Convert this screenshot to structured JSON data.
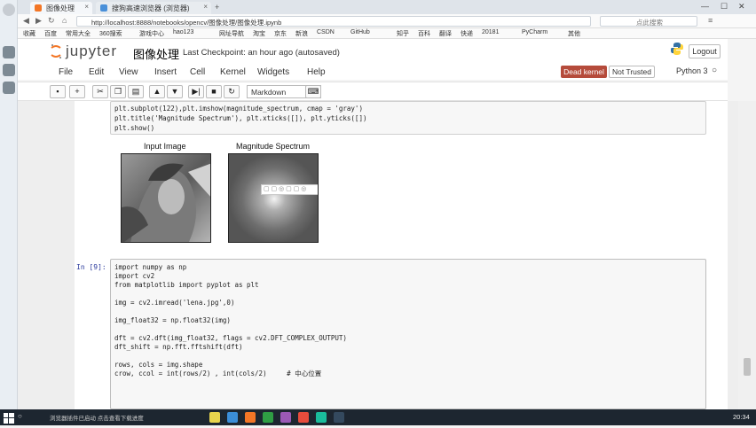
{
  "browser": {
    "tabs": [
      {
        "label": "图像处理"
      },
      {
        "label": "搜狗高速浏览器 (浏览器)"
      }
    ],
    "address": "http://localhost:8888/notebooks/opencv/图像处理/图像处理.ipynb",
    "search_placeholder": "点此搜索",
    "bookmarks": [
      "收藏",
      "百度",
      "常用大全",
      "360搜索",
      "游戏中心",
      "hao123",
      "网址导航",
      "淘宝",
      "京东",
      "新浪",
      "CSDN",
      "GitHub",
      "知乎",
      "百科",
      "翻译",
      "快递",
      "20181",
      "PyCharm",
      "其他"
    ]
  },
  "jupyter": {
    "logo_text": "jupyter",
    "notebook_name": "图像处理",
    "checkpoint": "Last Checkpoint: an hour ago (autosaved)",
    "logout_label": "Logout",
    "menu": [
      "File",
      "Edit",
      "View",
      "Insert",
      "Cell",
      "Kernel",
      "Widgets",
      "Help"
    ],
    "kernel_status": "Dead kernel",
    "trust_status": "Not Trusted",
    "kernel_name": "Python 3",
    "cell_type": "Markdown",
    "accent": "#f37626",
    "dead_kernel_color": "#b54b3b"
  },
  "cells": {
    "prev_code": [
      "plt.subplot(122),plt.imshow(magnitude_spectrum, cmap = 'gray')",
      "plt.title('Magnitude Spectrum'), plt.xticks([]), plt.yticks([])",
      "plt.show()"
    ],
    "output_titles": [
      "Input Image",
      "Magnitude Spectrum"
    ],
    "current_prompt": "In [9]:",
    "current_code": [
      "import numpy as np",
      "import cv2",
      "from matplotlib import pyplot as plt",
      "",
      "img = cv2.imread('lena.jpg',0)",
      "",
      "img_float32 = np.float32(img)",
      "",
      "dft = cv2.dft(img_float32, flags = cv2.DFT_COMPLEX_OUTPUT)",
      "dft_shift = np.fft.fftshift(dft)",
      "",
      "rows, cols = img.shape",
      "crow, ccol = int(rows/2) , int(cols/2)     # 中心位置"
    ]
  },
  "taskbar": {
    "time": "20:34",
    "notice": "浏览器插件已启动  点击查看下载进度"
  }
}
